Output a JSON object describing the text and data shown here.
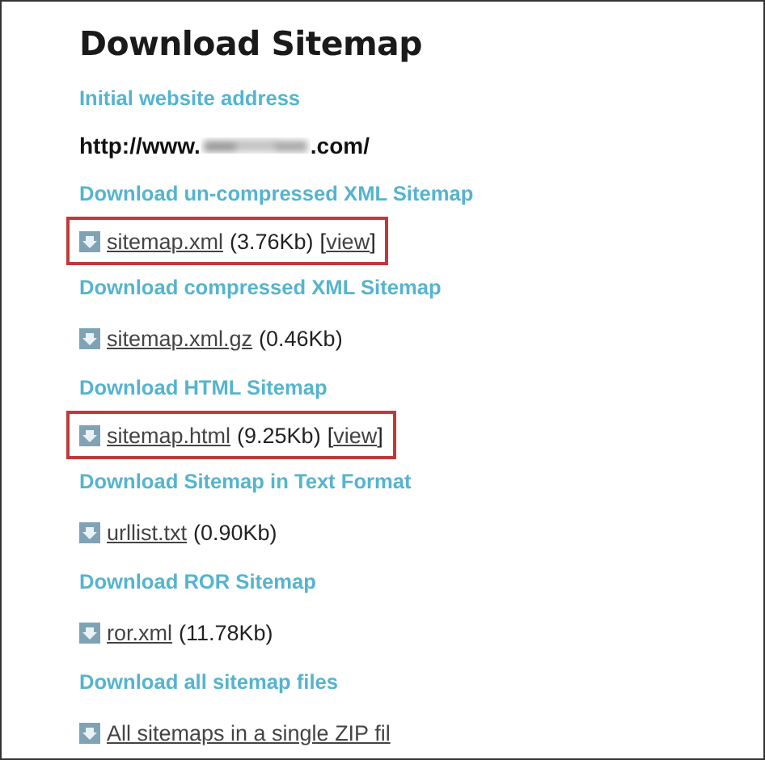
{
  "title": "Download Sitemap",
  "sections": [
    {
      "heading": "Initial website address",
      "kind": "address",
      "prefix": "http://www.",
      "suffix": ".com/"
    },
    {
      "heading": "Download un-compressed XML Sitemap",
      "kind": "file",
      "file": "sitemap.xml",
      "size": "(3.76Kb)",
      "view": {
        "open": "[",
        "label": "view",
        "close": "]"
      },
      "highlighted": true
    },
    {
      "heading": "Download compressed XML Sitemap",
      "kind": "file",
      "file": "sitemap.xml.gz",
      "size": "(0.46Kb)",
      "highlighted": false
    },
    {
      "heading": "Download HTML Sitemap",
      "kind": "file",
      "file": "sitemap.html",
      "size": "(9.25Kb)",
      "view": {
        "open": "[",
        "label": "view",
        "close": "]"
      },
      "highlighted": true
    },
    {
      "heading": "Download Sitemap in Text Format",
      "kind": "file",
      "file": "urllist.txt",
      "size": "(0.90Kb)",
      "highlighted": false
    },
    {
      "heading": "Download ROR Sitemap",
      "kind": "file",
      "file": "ror.xml",
      "size": "(11.78Kb)",
      "highlighted": false
    },
    {
      "heading": "Download all sitemap files",
      "kind": "file",
      "file": "All sitemaps in a single ZIP fil",
      "highlighted": false
    }
  ]
}
